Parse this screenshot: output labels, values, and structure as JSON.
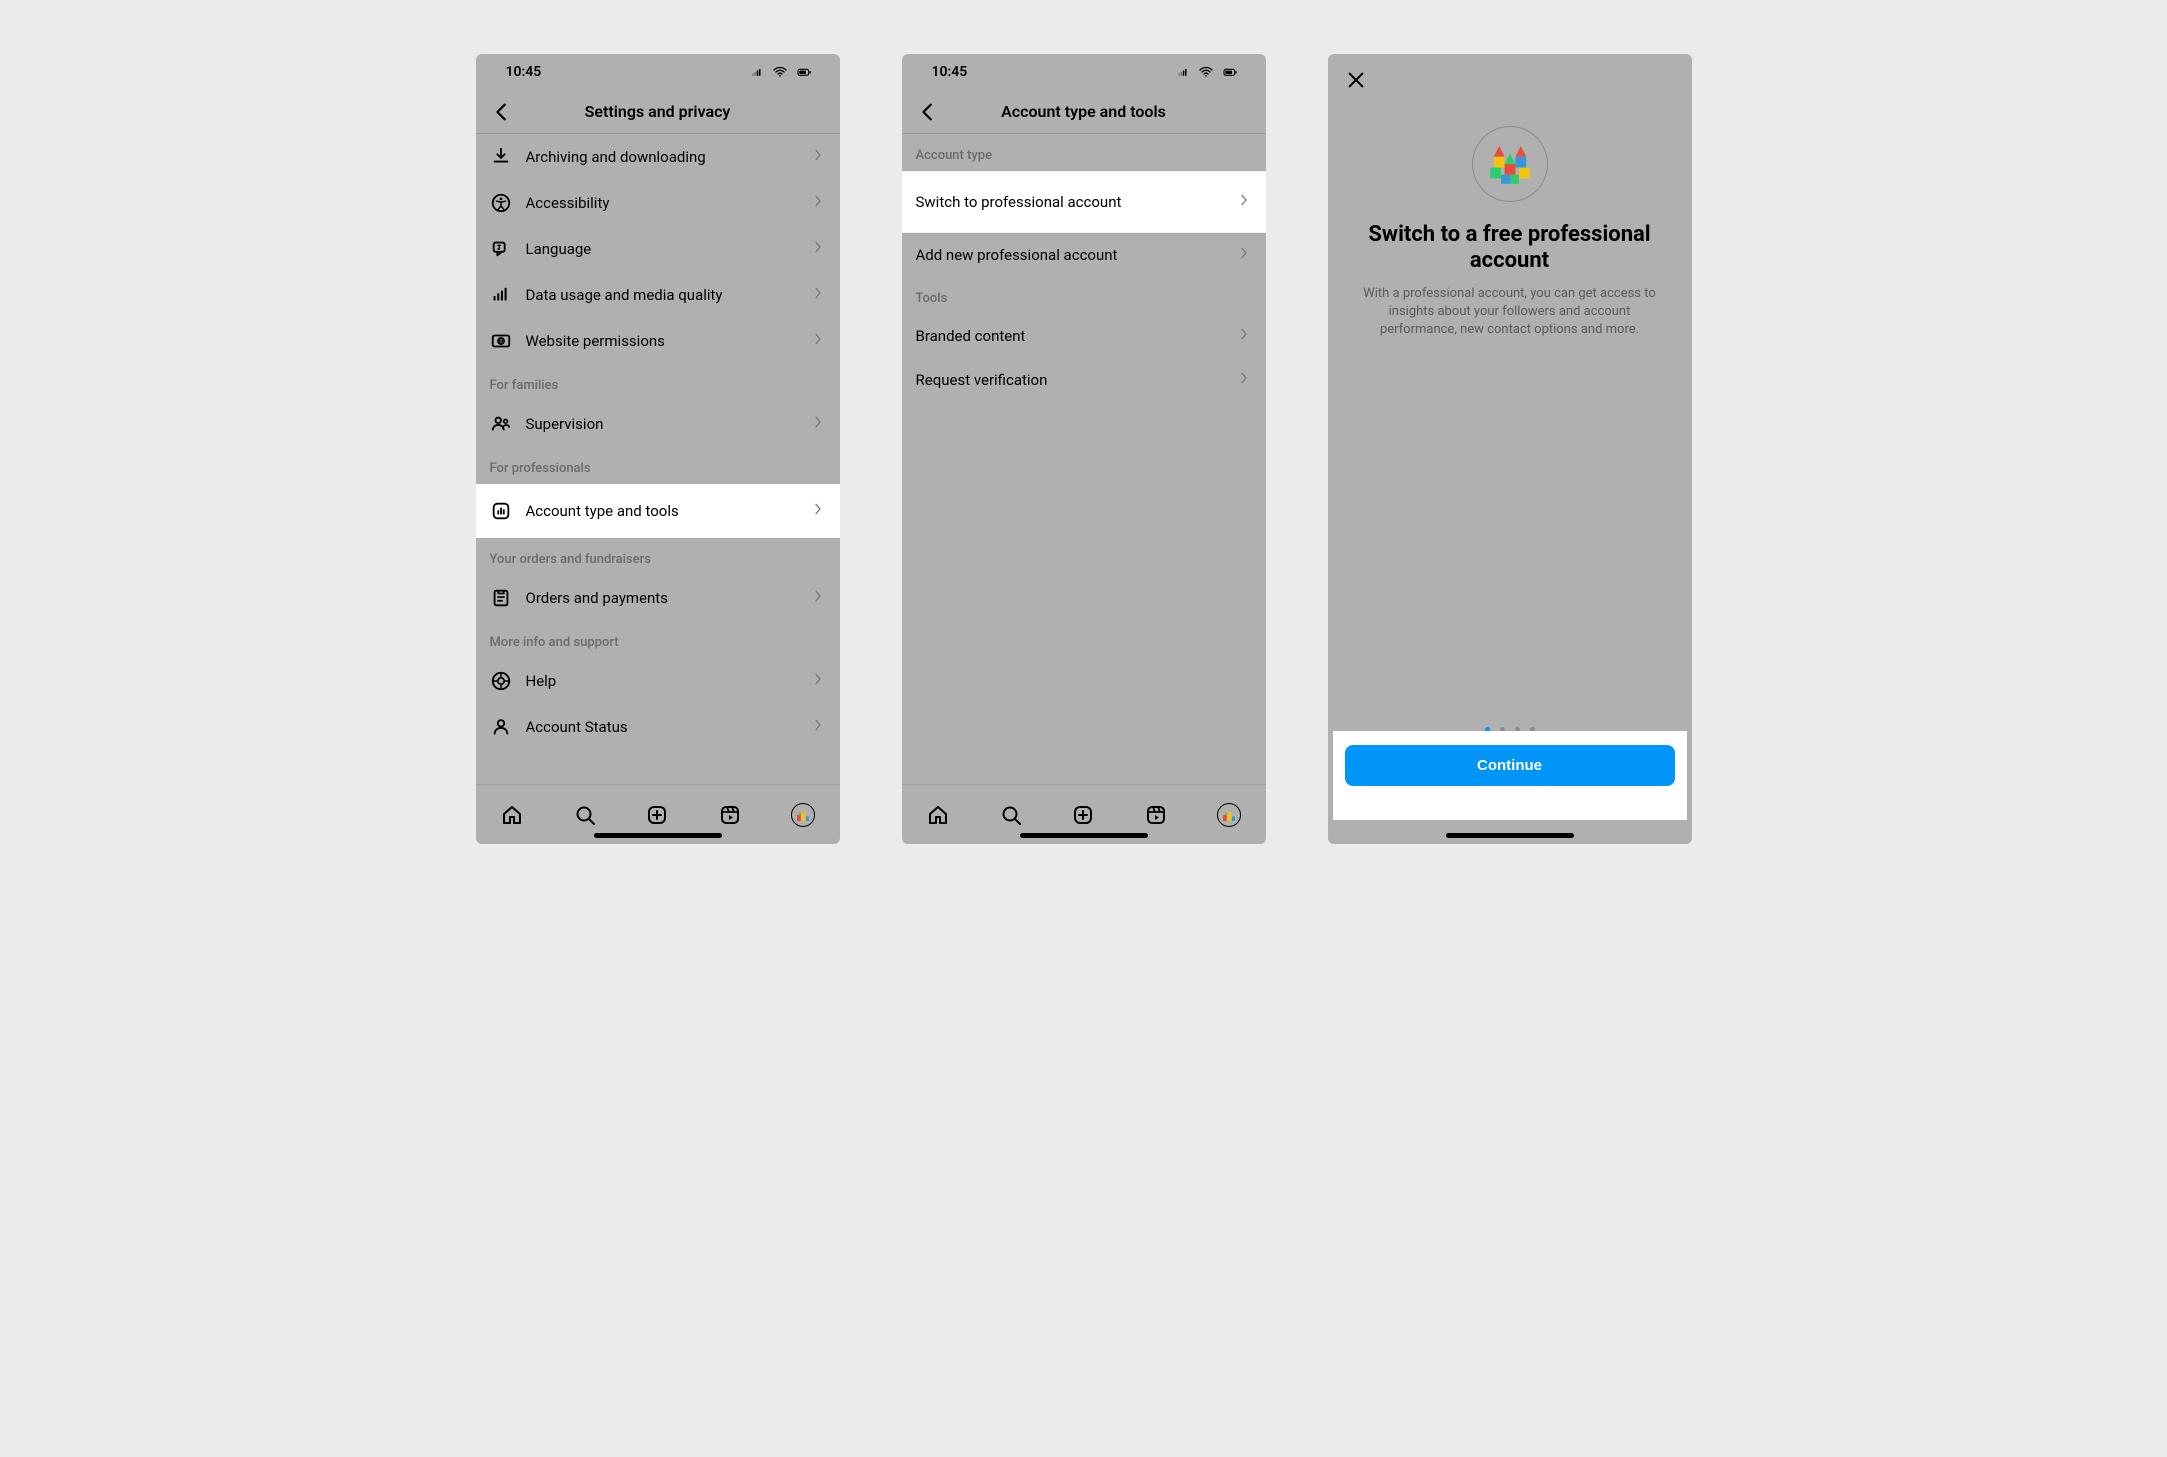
{
  "status": {
    "time": "10:45"
  },
  "screen1": {
    "title": "Settings and privacy",
    "rows": [
      {
        "icon": "download",
        "label": "Archiving and downloading"
      },
      {
        "icon": "accessibility",
        "label": "Accessibility"
      },
      {
        "icon": "language",
        "label": "Language"
      },
      {
        "icon": "data",
        "label": "Data usage and media quality"
      },
      {
        "icon": "globe",
        "label": "Website permissions"
      }
    ],
    "section_families": "For families",
    "row_supervision": {
      "label": "Supervision"
    },
    "section_pros": "For professionals",
    "row_acct_type": {
      "label": "Account type and tools",
      "highlight": true
    },
    "section_orders": "Your orders and fundraisers",
    "row_orders": {
      "label": "Orders and payments"
    },
    "section_more": "More info and support",
    "row_help": {
      "label": "Help"
    },
    "row_status": {
      "label": "Account Status"
    }
  },
  "screen2": {
    "title": "Account type and tools",
    "section_type": "Account type",
    "row_switch": {
      "label": "Switch to professional account",
      "highlight": true
    },
    "row_add": {
      "label": "Add new professional account"
    },
    "section_tools": "Tools",
    "row_branded": {
      "label": "Branded content"
    },
    "row_verify": {
      "label": "Request verification"
    }
  },
  "screen3": {
    "title": "Switch to a free professional account",
    "subtitle": "With a professional account, you can get access to insights about your followers and account performance, new contact options and more.",
    "cta": "Continue",
    "pager_count": 4,
    "pager_active": 0
  }
}
